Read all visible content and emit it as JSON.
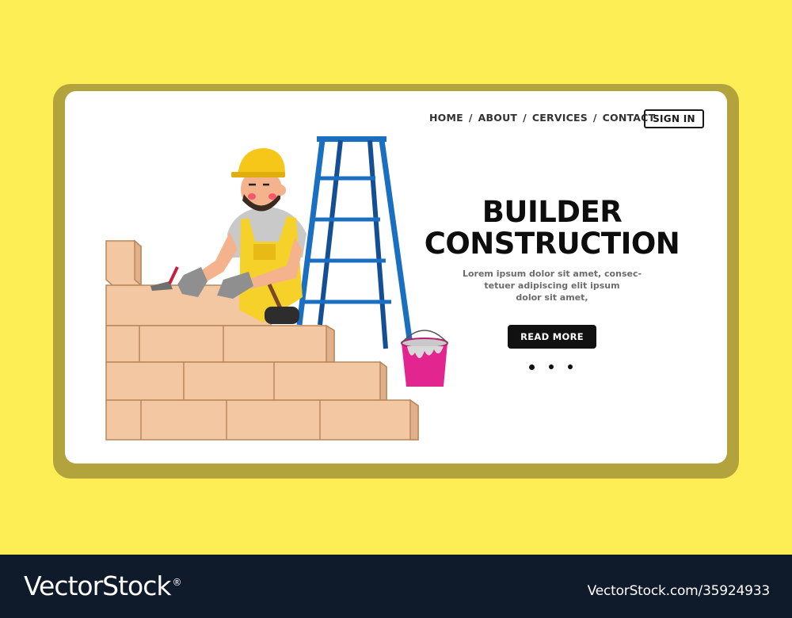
{
  "nav": {
    "items": [
      {
        "label": "HOME"
      },
      {
        "label": "ABOUT"
      },
      {
        "label": "CERVICES"
      },
      {
        "label": "CONTACT"
      }
    ],
    "separator": "/",
    "signin_label": "SIGN IN"
  },
  "hero": {
    "title_line1": "BUILDER",
    "title_line2": "CONSTRUCTION",
    "desc_line1": "Lorem ipsum dolor sit amet, consec-",
    "desc_line2": "tetuer adipiscing elit ipsum",
    "desc_line3": "dolor sit amet,",
    "cta_label": "READ MORE",
    "carousel": {
      "count": 3,
      "active": 1
    }
  },
  "footer": {
    "brand": "VectorStock",
    "brand_mark": "®",
    "image_id": "VectorStock.com/35924933"
  },
  "colors": {
    "background": "#fdee55",
    "frame": "#b2a33c",
    "button": "#111111",
    "footer": "#0f1a2b"
  }
}
